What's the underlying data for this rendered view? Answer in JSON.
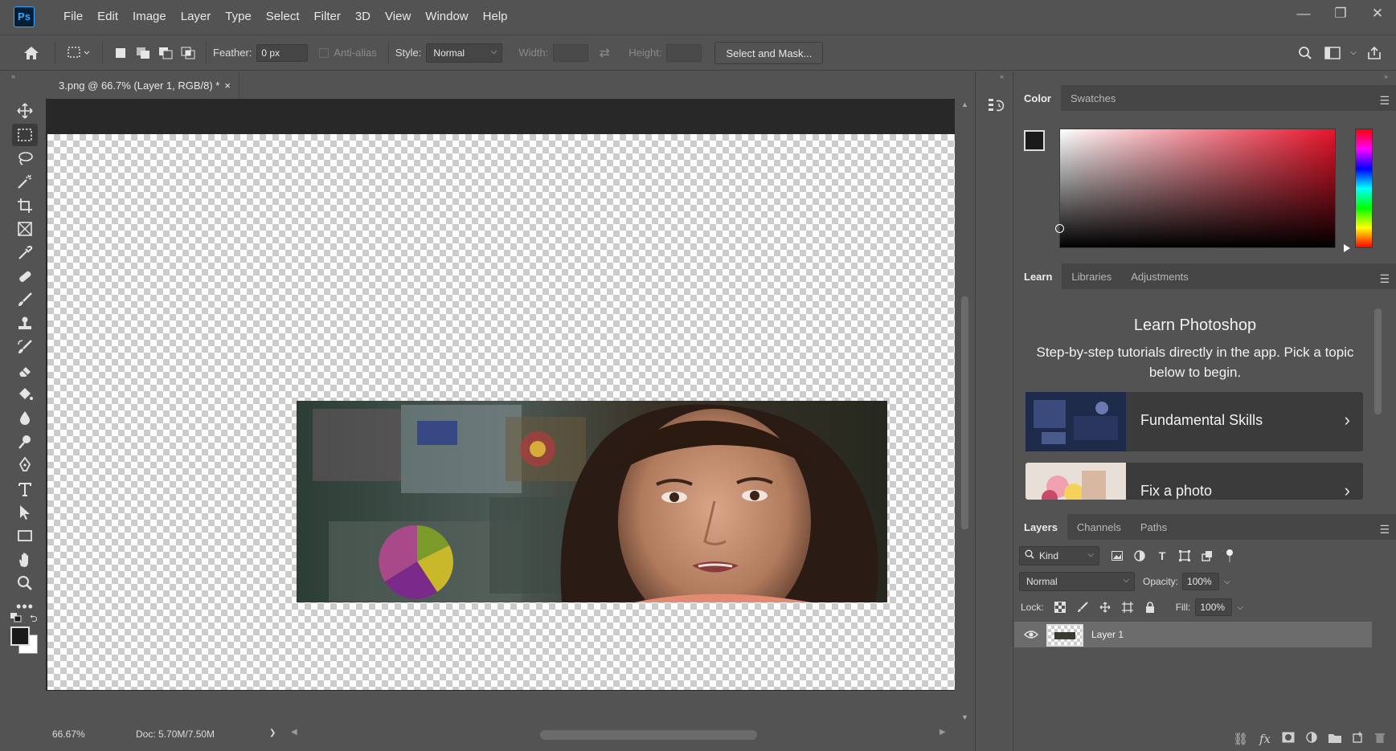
{
  "app": {
    "logo": "Ps",
    "menu": [
      "File",
      "Edit",
      "Image",
      "Layer",
      "Type",
      "Select",
      "Filter",
      "3D",
      "View",
      "Window",
      "Help"
    ],
    "window_controls": [
      "—",
      "❐",
      "✕"
    ]
  },
  "options_bar": {
    "feather_label": "Feather:",
    "feather_value": "0 px",
    "antialias_label": "Anti-alias",
    "style_label": "Style:",
    "style_value": "Normal",
    "width_label": "Width:",
    "height_label": "Height:",
    "select_mask_label": "Select and Mask..."
  },
  "document": {
    "tab_title": "3.png @ 66.7% (Layer 1, RGB/8) *",
    "tab_close": "×"
  },
  "status": {
    "zoom": "66.67%",
    "doc_size": "Doc: 5.70M/7.50M",
    "arrow": "❯"
  },
  "color_panel": {
    "tabs": [
      "Color",
      "Swatches"
    ],
    "accent": "#e8142a",
    "fg_color": "#1a1a1a",
    "bg_color": "#ffffff"
  },
  "learn_panel": {
    "tabs": [
      "Learn",
      "Libraries",
      "Adjustments"
    ],
    "title": "Learn Photoshop",
    "subtitle": "Step-by-step tutorials directly in the app. Pick a topic below to begin.",
    "cards": [
      {
        "label": "Fundamental Skills"
      },
      {
        "label": "Fix a photo"
      }
    ]
  },
  "layers_panel": {
    "tabs": [
      "Layers",
      "Channels",
      "Paths"
    ],
    "filter_value": "Kind",
    "blend_mode": "Normal",
    "opacity_label": "Opacity:",
    "opacity_value": "100%",
    "lock_label": "Lock:",
    "fill_label": "Fill:",
    "fill_value": "100%",
    "layers": [
      {
        "name": "Layer 1",
        "visible": true,
        "selected": true
      }
    ]
  }
}
